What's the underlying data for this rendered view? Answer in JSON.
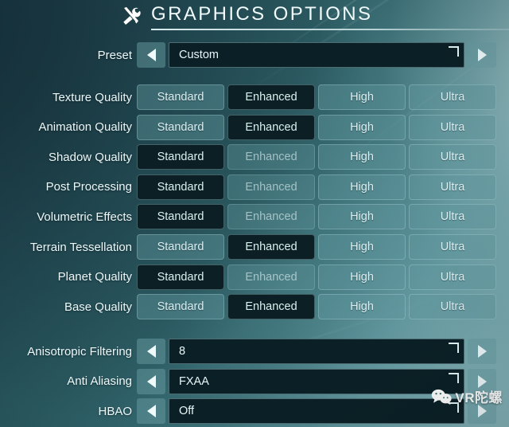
{
  "header": {
    "icon": "tools-icon",
    "title": "GRAPHICS OPTIONS"
  },
  "preset_row": {
    "label": "Preset",
    "value": "Custom",
    "left_arrow": "◀",
    "right_arrow": "▶"
  },
  "quality_columns": [
    "Standard",
    "Enhanced",
    "High",
    "Ultra"
  ],
  "quality_rows": [
    {
      "label": "Texture Quality",
      "selected": "Enhanced",
      "dimmed": []
    },
    {
      "label": "Animation Quality",
      "selected": "Enhanced",
      "dimmed": []
    },
    {
      "label": "Shadow Quality",
      "selected": "Standard",
      "dimmed": [
        "Enhanced"
      ]
    },
    {
      "label": "Post Processing",
      "selected": "Standard",
      "dimmed": [
        "Enhanced"
      ]
    },
    {
      "label": "Volumetric Effects",
      "selected": "Standard",
      "dimmed": [
        "Enhanced"
      ]
    },
    {
      "label": "Terrain Tessellation",
      "selected": "Enhanced",
      "dimmed": []
    },
    {
      "label": "Planet Quality",
      "selected": "Standard",
      "dimmed": [
        "Enhanced"
      ]
    },
    {
      "label": "Base Quality",
      "selected": "Enhanced",
      "dimmed": []
    }
  ],
  "stepper_rows": [
    {
      "label": "Anisotropic Filtering",
      "value": "8"
    },
    {
      "label": "Anti Aliasing",
      "value": "FXAA"
    },
    {
      "label": "HBAO",
      "value": "Off"
    }
  ],
  "watermark": {
    "icon": "wechat-icon",
    "text": "VR陀螺"
  },
  "colors": {
    "selected_bg": "#0c1f24",
    "unselected_bg": "#60969c",
    "field_bg": "#0b2026",
    "text": "#eef8f9"
  }
}
